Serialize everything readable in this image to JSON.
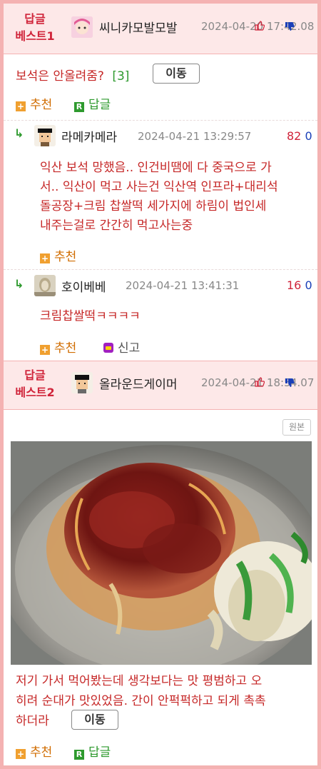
{
  "best1": {
    "label_line1": "답글",
    "label_line2": "베스트1",
    "username": "씨니카모발모발",
    "datetime": "2024-04-20 17:4",
    "datetime_overlap": "2.08",
    "body": "보석은 안올려줌?",
    "reply_count": "[3]",
    "move_label": "이동",
    "recommend_label": "추천",
    "reply_label": "답글",
    "replies": [
      {
        "username": "라메카메라",
        "datetime": "2024-04-21 13:29:57",
        "up": "82",
        "down": "0",
        "body": [
          "익산 보석 망했음.. 인건비땜에 다 중국으로 가",
          "서.. 익산이 먹고 사는건 익산역 인프라+대리석",
          "돌공장+크림 찹쌀떡 세가지에 하림이 법인세",
          "내주는걸로 간간히 먹고사는중"
        ],
        "recommend_label": "추천"
      },
      {
        "username": "호이베베",
        "datetime": "2024-04-21 13:41:31",
        "up": "16",
        "down": "0",
        "body": [
          "크림찹쌀떡ㅋㅋㅋㅋ"
        ],
        "recommend_label": "추천",
        "report_label": "신고"
      }
    ]
  },
  "best2": {
    "label_line1": "답글",
    "label_line2": "베스트2",
    "username": "올라운드게이머",
    "datetime": "2024-04-21 18:5",
    "datetime_overlap": "4.07",
    "original_label": "원본",
    "body": [
      "저기 가서 먹어봤는데 생각보다는 맛 평범하고 오",
      "히려 순대가 맛있었음. 간이 안퍽퍽하고 되게 촉촉",
      "하더라"
    ],
    "move_label": "이동",
    "recommend_label": "추천",
    "reply_label": "답글"
  },
  "colors": {
    "accent": "#d0243a",
    "border": "#f4b2b2",
    "header_bg": "#fde8e8",
    "body_text": "#c62828"
  },
  "icons": {
    "thumb_up": "thumb-up-icon",
    "thumb_down": "thumb-down-icon",
    "reply_arrow": "reply-arrow-icon"
  }
}
